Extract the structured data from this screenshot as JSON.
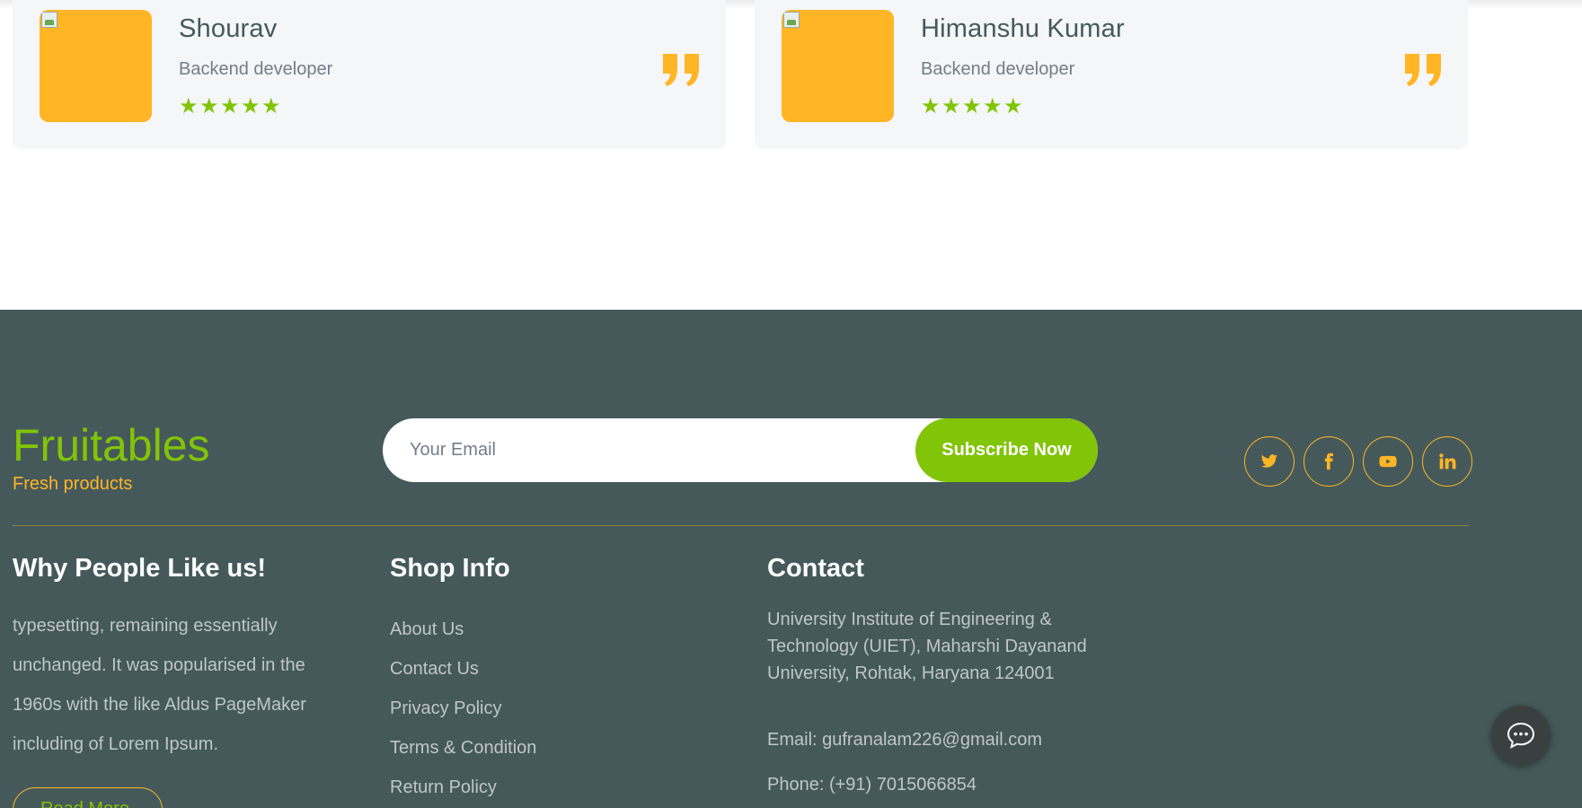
{
  "testimonials": [
    {
      "name": "Shourav",
      "role": "Backend developer",
      "rating": 5
    },
    {
      "name": "Himanshu Kumar",
      "role": "Backend developer",
      "rating": 5
    }
  ],
  "footer": {
    "brand": "Fruitables",
    "tagline": "Fresh products",
    "subscribe": {
      "placeholder": "Your Email",
      "button_label": "Subscribe Now"
    },
    "socials": [
      "twitter-icon",
      "facebook-icon",
      "youtube-icon",
      "linkedin-icon"
    ],
    "why": {
      "title": "Why People Like us!",
      "text": "typesetting, remaining essentially unchanged. It was popularised in the 1960s with the like Aldus PageMaker including of Lorem Ipsum.",
      "read_more": "Read More"
    },
    "shop_info": {
      "title": "Shop Info",
      "links": [
        "About Us",
        "Contact Us",
        "Privacy Policy",
        "Terms & Condition",
        "Return Policy"
      ]
    },
    "contact": {
      "title": "Contact",
      "address": "University Institute of Engineering & Technology (UIET), Maharshi Dayanand University, Rohtak, Haryana 124001",
      "email": "Email: gufranalam226@gmail.com",
      "phone": "Phone: (+91) 7015066854"
    }
  },
  "colors": {
    "primary_green": "#81c408",
    "accent_orange": "#ffb524",
    "footer_bg": "#45595b",
    "card_bg": "#f4f6f8"
  }
}
